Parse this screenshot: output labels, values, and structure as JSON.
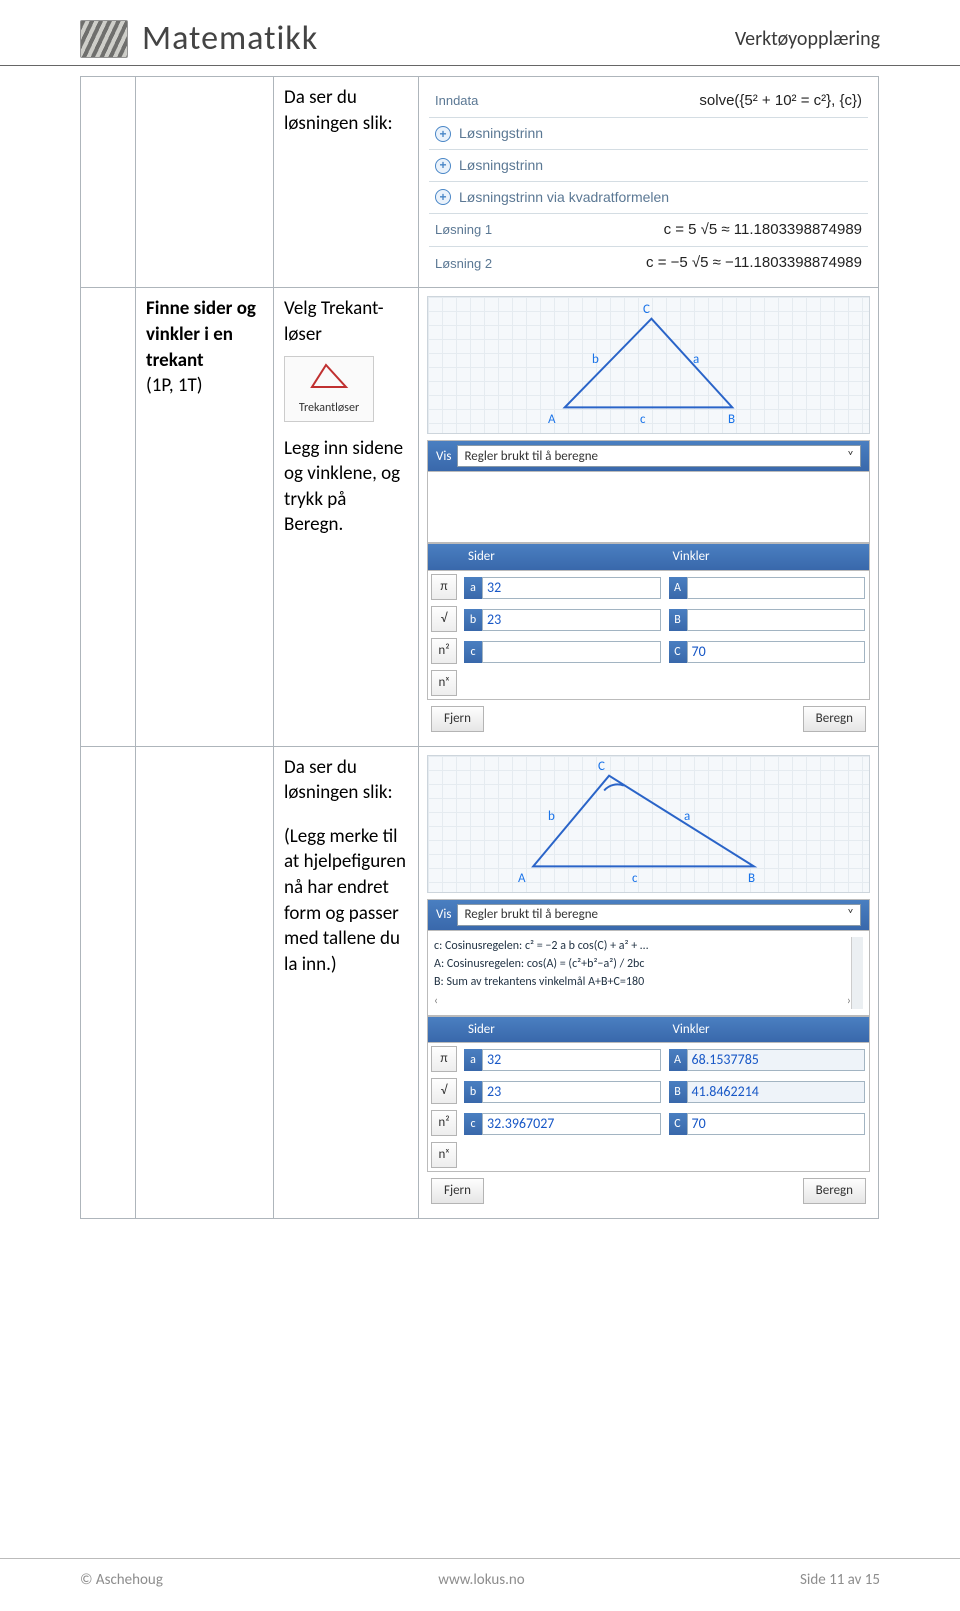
{
  "header": {
    "logo_alt": "Matematikk logo",
    "brand": "Matematikk",
    "right_text": "Verktøyopplæring"
  },
  "row1": {
    "col_b": "",
    "col_c": "Da ser du løsningen slik:",
    "solve": {
      "inndata_label": "Inndata",
      "inndata_math": "solve({5² + 10² = c²}, {c})",
      "steps": [
        "Løsningstrinn",
        "Løsningstrinn",
        "Løsningstrinn via kvadratformelen"
      ],
      "sol1_label": "Løsning 1",
      "sol1_math": "c = 5 √5 ≈ 11.1803398874989",
      "sol2_label": "Løsning 2",
      "sol2_math": "c = −5 √5 ≈ −11.1803398874989"
    }
  },
  "row2": {
    "col_b_line1": "Finne sider og vinkler i en trekant",
    "col_b_line2": "(1P, 1T)",
    "col_c_a": "Velg Trekant-løser",
    "trekant_label": "Trekantløser",
    "col_c_b": "Legg inn sidene og vinklene, og trykk på Beregn.",
    "vis_label": "Vis",
    "vis_value": "Regler brukt til å beregne",
    "sider_label": "Sider",
    "vinkler_label": "Vinkler",
    "sides": {
      "a": "32",
      "b": "23",
      "c": ""
    },
    "angles": {
      "A": "",
      "B": "",
      "C": "70"
    },
    "sym_buttons": [
      "π",
      "√",
      "n²",
      "nˣ"
    ],
    "fjern_btn": "Fjern",
    "beregn_btn": "Beregn",
    "tri": {
      "A": "A",
      "B": "B",
      "C": "C",
      "a": "a",
      "b": "b",
      "c": "c"
    }
  },
  "row3": {
    "col_c_a": "Da ser du løsningen slik:",
    "col_c_b": "(Legg merke til at hjelpefiguren nå har endret form og passer med tallene du la inn.)",
    "vis_label": "Vis",
    "vis_value": "Regler brukt til å beregne",
    "result_lines": [
      "c: Cosinusregelen: c² = −2 a b cos(C) + a² + …",
      "A: Cosinusregelen: cos(A) = (c²+b²−a²) / 2bc",
      "B: Sum av trekantens vinkelmål A+B+C=180"
    ],
    "sider_label": "Sider",
    "vinkler_label": "Vinkler",
    "sides": {
      "a": "32",
      "b": "23",
      "c": "32.3967027"
    },
    "angles": {
      "A": "68.1537785",
      "B": "41.8462214",
      "C": "70"
    },
    "sym_buttons": [
      "π",
      "√",
      "n²",
      "nˣ"
    ],
    "fjern_btn": "Fjern",
    "beregn_btn": "Beregn",
    "tri": {
      "A": "A",
      "B": "B",
      "C": "C",
      "a": "a",
      "b": "b",
      "c": "c"
    }
  },
  "footer": {
    "left": "© Aschehoug",
    "center": "www.lokus.no",
    "right": "Side 11 av 15"
  }
}
